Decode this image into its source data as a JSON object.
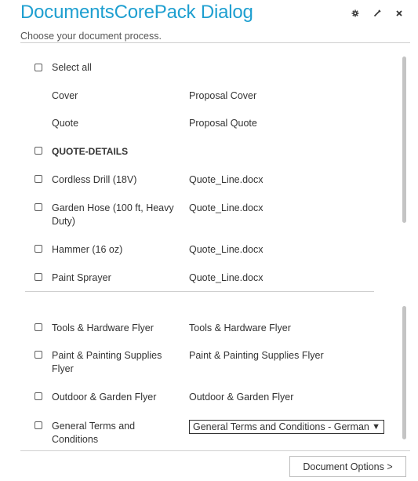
{
  "dialog": {
    "title": "DocumentsCorePack Dialog",
    "subtitle": "Choose your document process.",
    "icons": [
      "gear-icon",
      "edit-icon",
      "close-icon"
    ]
  },
  "top_list": {
    "select_all_label": "Select all",
    "rows": [
      {
        "label": "Cover",
        "value": "Proposal Cover",
        "checkbox": false
      },
      {
        "label": "Quote",
        "value": "Proposal Quote",
        "checkbox": false
      },
      {
        "label": "QUOTE-DETAILS",
        "value": "",
        "checkbox": true,
        "bold": true
      },
      {
        "label": "Cordless Drill (18V)",
        "value": "Quote_Line.docx",
        "checkbox": true
      },
      {
        "label": "Garden Hose (100 ft, Heavy Duty)",
        "value": "Quote_Line.docx",
        "checkbox": true
      },
      {
        "label": "Hammer (16 oz)",
        "value": "Quote_Line.docx",
        "checkbox": true
      },
      {
        "label": "Paint Sprayer",
        "value": "Quote_Line.docx",
        "checkbox": true
      }
    ]
  },
  "bottom_list": {
    "rows": [
      {
        "label": "Tools & Hardware Flyer",
        "value": "Tools & Hardware Flyer"
      },
      {
        "label": "Paint & Painting Supplies Flyer",
        "value": "Paint & Painting Supplies Flyer"
      },
      {
        "label": "Outdoor & Garden Flyer",
        "value": "Outdoor & Garden Flyer"
      },
      {
        "label": "General Terms and Conditions",
        "select_value": "General Terms and Conditions - German"
      }
    ]
  },
  "footer": {
    "document_options_label": "Document Options >"
  }
}
